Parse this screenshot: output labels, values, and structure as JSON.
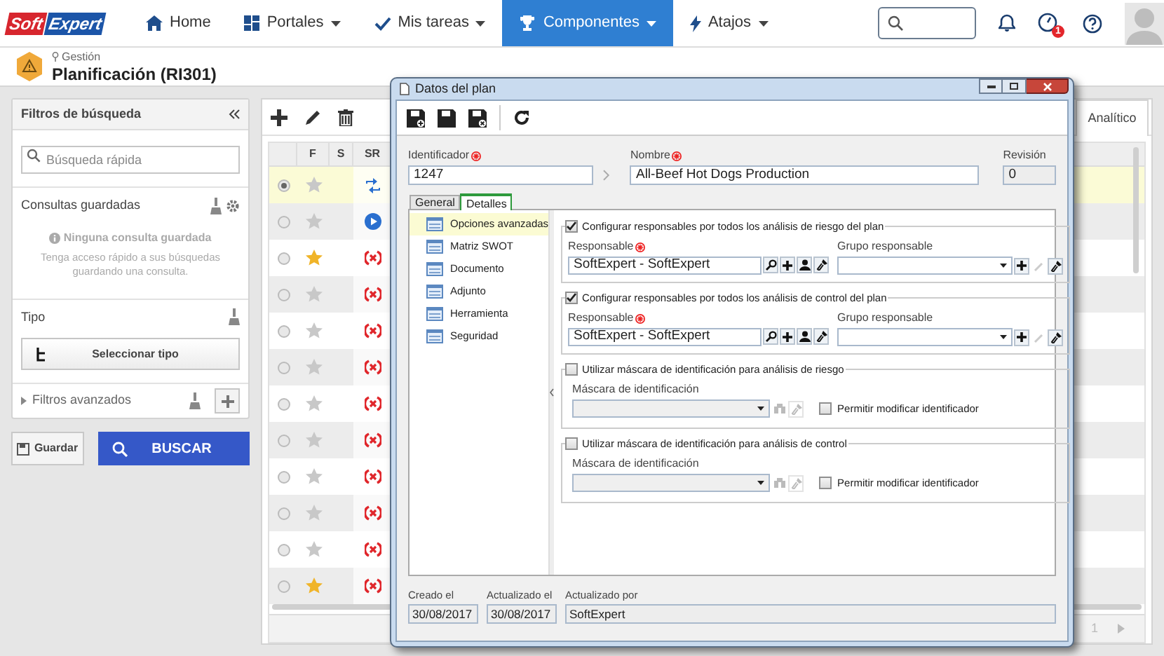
{
  "logo": {
    "part_1": "Soft",
    "part_2": "Expert"
  },
  "nav": [
    {
      "label": "Home",
      "kind": "home",
      "dropdown": false,
      "selected": false
    },
    {
      "label": "Portales",
      "kind": "grid",
      "dropdown": true,
      "selected": false
    },
    {
      "label": "Mis tareas",
      "kind": "check",
      "dropdown": true,
      "selected": false
    },
    {
      "label": "Componentes",
      "kind": "trophy",
      "dropdown": true,
      "selected": true
    },
    {
      "label": "Atajos",
      "kind": "bolt",
      "dropdown": true,
      "selected": false
    }
  ],
  "notification_badge": "1",
  "header": {
    "breadcrumb": "Gestión",
    "title": "Planificación (RI301)"
  },
  "filters": {
    "title": "Filtros de búsqueda",
    "search_placeholder": "Búsqueda rápida",
    "saved_title": "Consultas guardadas",
    "saved_empty": "Ninguna consulta guardada",
    "saved_hint": "Tenga acceso rápido a sus búsquedas guardando una consulta.",
    "type_title": "Tipo",
    "type_button": "Seleccionar tipo",
    "advanced": "Filtros avanzados",
    "save_button": "Guardar",
    "search_button": "BUSCAR"
  },
  "grid": {
    "columns": [
      "F",
      "S",
      "SR"
    ],
    "tab": "Analítico",
    "page": "1",
    "rows": [
      {
        "selected": true,
        "starred": false,
        "kind": "transfer"
      },
      {
        "selected": false,
        "starred": false,
        "kind": "play"
      },
      {
        "selected": false,
        "starred": true,
        "kind": "cancelled"
      },
      {
        "selected": false,
        "starred": false,
        "kind": "cancelled"
      },
      {
        "selected": false,
        "starred": false,
        "kind": "cancelled"
      },
      {
        "selected": false,
        "starred": false,
        "kind": "cancelled"
      },
      {
        "selected": false,
        "starred": false,
        "kind": "cancelled"
      },
      {
        "selected": false,
        "starred": false,
        "kind": "cancelled"
      },
      {
        "selected": false,
        "starred": false,
        "kind": "cancelled"
      },
      {
        "selected": false,
        "starred": false,
        "kind": "cancelled"
      },
      {
        "selected": false,
        "starred": false,
        "kind": "cancelled"
      },
      {
        "selected": false,
        "starred": true,
        "kind": "cancelled"
      }
    ]
  },
  "dialog": {
    "title": "Datos del plan",
    "identificador": {
      "label": "Identificador",
      "value": "1247"
    },
    "nombre": {
      "label": "Nombre",
      "value": "All-Beef Hot Dogs Production"
    },
    "revision": {
      "label": "Revisión",
      "value": "0"
    },
    "tabs": [
      {
        "label": "General",
        "selected": false
      },
      {
        "label": "Detalles",
        "selected": true
      }
    ],
    "menu": [
      {
        "label": "Opciones avanzadas",
        "selected": true
      },
      {
        "label": "Matriz SWOT",
        "selected": false
      },
      {
        "label": "Documento",
        "selected": false
      },
      {
        "label": "Adjunto",
        "selected": false
      },
      {
        "label": "Herramienta",
        "selected": false
      },
      {
        "label": "Seguridad",
        "selected": false
      }
    ],
    "sections": [
      {
        "kind": "responsables",
        "label": "Configurar responsables por todos los análisis de riesgo del plan",
        "checked": true,
        "responsable_label": "Responsable",
        "responsable_value": "SoftExpert - SoftExpert",
        "group_label": "Grupo responsable"
      },
      {
        "kind": "responsables",
        "label": "Configurar responsables por todos los análisis de control del plan",
        "checked": true,
        "responsable_label": "Responsable",
        "responsable_value": "SoftExpert - SoftExpert",
        "group_label": "Grupo responsable"
      },
      {
        "kind": "mask",
        "label": "Utilizar máscara de identificación para análisis de riesgo",
        "checked": false,
        "mask_label": "Máscara de identificación",
        "allow_label": "Permitir modificar identificador",
        "allow_checked": false
      },
      {
        "kind": "mask",
        "label": "Utilizar máscara de identificación para análisis de control",
        "checked": false,
        "mask_label": "Máscara de identificación",
        "allow_label": "Permitir modificar identificador",
        "allow_checked": false
      }
    ],
    "footer": [
      {
        "label": "Creado el",
        "value": "30/08/2017"
      },
      {
        "label": "Actualizado el",
        "value": "30/08/2017"
      },
      {
        "label": "Actualizado por",
        "value": "SoftExpert"
      }
    ]
  }
}
